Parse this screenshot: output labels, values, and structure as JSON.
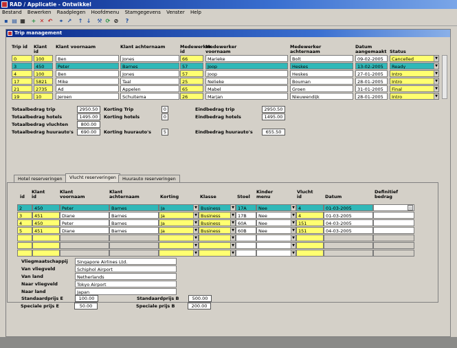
{
  "window": {
    "title": "RAD / Applicatie - Ontwikkel"
  },
  "menu": [
    "Bestand",
    "Bewerken",
    "Raadplegen",
    "Hoofdmenu",
    "Stamgegevens",
    "Venster",
    "Help"
  ],
  "toolbar": {
    "help": "?"
  },
  "trip_window": {
    "title": "Trip management"
  },
  "trip_table": {
    "headers": [
      "Trip id",
      "Klant id",
      "Klant voornaam",
      "Klant achternaam",
      "Medewerker id",
      "Medewerker voornaam",
      "Medewerker achternaam",
      "Datum aangemaakt",
      "Status"
    ],
    "rows": [
      [
        "0",
        "100",
        "Ben",
        "Jones",
        "66",
        "Marieke",
        "Bolt",
        "09-02-2005",
        "Cancelled"
      ],
      [
        "3",
        "450",
        "Peter",
        "Barnes",
        "57",
        "Joop",
        "Heskes",
        "13-02-2005",
        "Ready"
      ],
      [
        "4",
        "100",
        "Ben",
        "Jones",
        "57",
        "Joop",
        "Heskes",
        "27-01-2005",
        "Intro"
      ],
      [
        "17",
        "5821",
        "Mike",
        "Taal",
        "25",
        "Nelieke",
        "Bouman",
        "28-01-2005",
        "Intro"
      ],
      [
        "21",
        "2735",
        "Ad",
        "Appelen",
        "65",
        "Mabel",
        "Groen",
        "31-01-2005",
        "Final"
      ],
      [
        "19",
        "10",
        "Jeroen",
        "Schuitema",
        "26",
        "Marjan",
        "Nieuwendijk",
        "28-01-2005",
        "Intro"
      ]
    ]
  },
  "totals": {
    "l1": "Totaalbedrag trip",
    "v1": "2950.50",
    "l2": "Totaalbedrag hotels",
    "v2": "1495.00",
    "l3": "Totaalbedrag vluchten",
    "v3": "800.00",
    "l4": "Totaalbedrag huurauto's",
    "v4": "690.00",
    "k1": "Korting Trip",
    "kv1": "0",
    "k2": "Korting hotels",
    "kv2": "0",
    "k3": "Korting huurauto's",
    "kv3": "5",
    "e1": "Eindbedrag trip",
    "ev1": "2950.50",
    "e2": "Eindbedrag hotels",
    "ev2": "1495.00",
    "e3": "Eindbedrag huurauto's",
    "ev3": "655.50"
  },
  "tabs": [
    "Hotel reserveringen",
    "Vlucht reserveringen",
    "Huurauto reserveringen"
  ],
  "flight_table": {
    "headers": [
      "id",
      "Klant id",
      "Klant voornaam",
      "Klant achternaam",
      "Korting",
      "Klasse",
      "Stoel",
      "Kinder menu",
      "Vlucht id",
      "Datum",
      "Definitief bedrag"
    ],
    "rows": [
      [
        "2",
        "450",
        "Peter",
        "Barnes",
        "Ja",
        "Business",
        "17A",
        "Nee",
        "4",
        "01-03-2005",
        ""
      ],
      [
        "3",
        "451",
        "Diane",
        "Barnes",
        "Ja",
        "Business",
        "17B",
        "Nee",
        "4",
        "01-03-2005",
        ""
      ],
      [
        "4",
        "450",
        "Peter",
        "Barnes",
        "Ja",
        "Business",
        "60A",
        "Nee",
        "151",
        "04-03-2005",
        ""
      ],
      [
        "5",
        "451",
        "Diane",
        "Barnes",
        "Ja",
        "Business",
        "60B",
        "Nee",
        "151",
        "04-03-2005",
        ""
      ]
    ]
  },
  "flight_info": {
    "l1": "Vliegmaatschappij",
    "v1": "Singapore Airlines Ltd.",
    "l2": "Van vliegveld",
    "v2": "Schiphol Airport",
    "l3": "Van land",
    "v3": "Netherlands",
    "l4": "Naar vliegveld",
    "v4": "Tokyo Airport",
    "l5": "Naar land",
    "v5": "Japan",
    "p1": "Standaardprijs E",
    "pv1": "100.00",
    "p2": "Speciale prijs E",
    "pv2": "50.00",
    "p3": "Standaardprijs B",
    "pv3": "500.00",
    "p4": "Speciale prijs B",
    "pv4": "200.00"
  },
  "colors": {
    "selected": "#30b8b8",
    "editable": "#ffff70",
    "titlebar": "#0a2a8a"
  }
}
